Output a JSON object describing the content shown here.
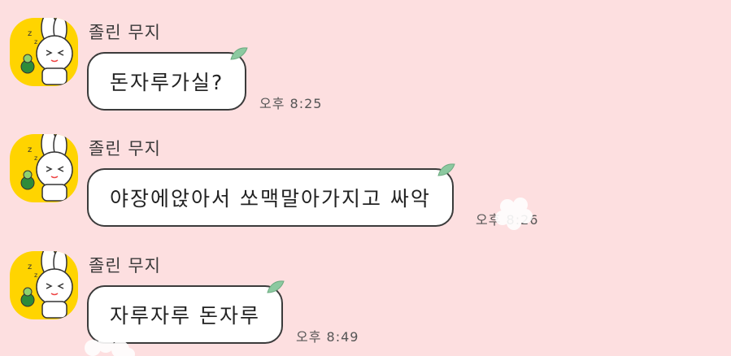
{
  "messages": [
    {
      "sender": "졸린 무지",
      "text": "돈자루가실?",
      "time": "오후 8:25"
    },
    {
      "sender": "졸린 무지",
      "text": "야장에앉아서 쏘맥말아가지고 싸악",
      "time": "오후 8:26"
    },
    {
      "sender": "졸린 무지",
      "text": "자루자루 돈자루",
      "time": "오후 8:49"
    }
  ],
  "theme": {
    "background": "#fddfe0",
    "avatar": "#ffd400",
    "leaf": "#8cc9a0"
  },
  "icons": {
    "avatar": "muzi-sleepy-avatar-icon",
    "leaf": "leaf-icon",
    "flower": "flower-icon"
  }
}
